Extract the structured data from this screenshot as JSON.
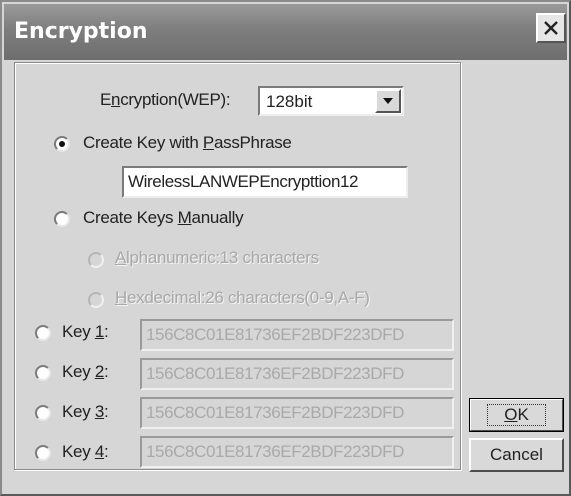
{
  "window": {
    "title": "Encryption",
    "close_icon": "close-icon"
  },
  "encryption_select": {
    "label_pre": "E",
    "label_mnemonic": "n",
    "label_post": "cryption(WEP):",
    "value": "128bit",
    "arrow_icon": "chevron-down-icon"
  },
  "passphrase_option": {
    "label_pre": "Create Key with ",
    "label_mnemonic": "P",
    "label_post": "assPhrase",
    "selected": true,
    "value": "WirelessLANWEPEncrypttion12"
  },
  "manual_option": {
    "label_pre": "Create Keys ",
    "label_mnemonic": "M",
    "label_post": "anually",
    "selected": false
  },
  "manual_suboptions": [
    {
      "mnemonic": "A",
      "label_post": "lphanumeric:13 characters"
    },
    {
      "mnemonic": "H",
      "label_post": "exdecimal:26 characters(0-9,A-F)"
    }
  ],
  "keys": [
    {
      "label_pre": "Key ",
      "mnemonic": "1",
      "label_post": ":",
      "value": "156C8C01E81736EF2BDF223DFD"
    },
    {
      "label_pre": "Key ",
      "mnemonic": "2",
      "label_post": ":",
      "value": "156C8C01E81736EF2BDF223DFD"
    },
    {
      "label_pre": "Key ",
      "mnemonic": "3",
      "label_post": ":",
      "value": "156C8C01E81736EF2BDF223DFD"
    },
    {
      "label_pre": "Key ",
      "mnemonic": "4",
      "label_post": ":",
      "value": "156C8C01E81736EF2BDF223DFD"
    }
  ],
  "buttons": {
    "ok_mnemonic": "O",
    "ok_post": "K",
    "cancel": "Cancel"
  },
  "colors": {
    "titlebar": "#7e7e7e",
    "dialog_face": "#d6d6d6",
    "disabled_text": "#a8a8a8"
  }
}
